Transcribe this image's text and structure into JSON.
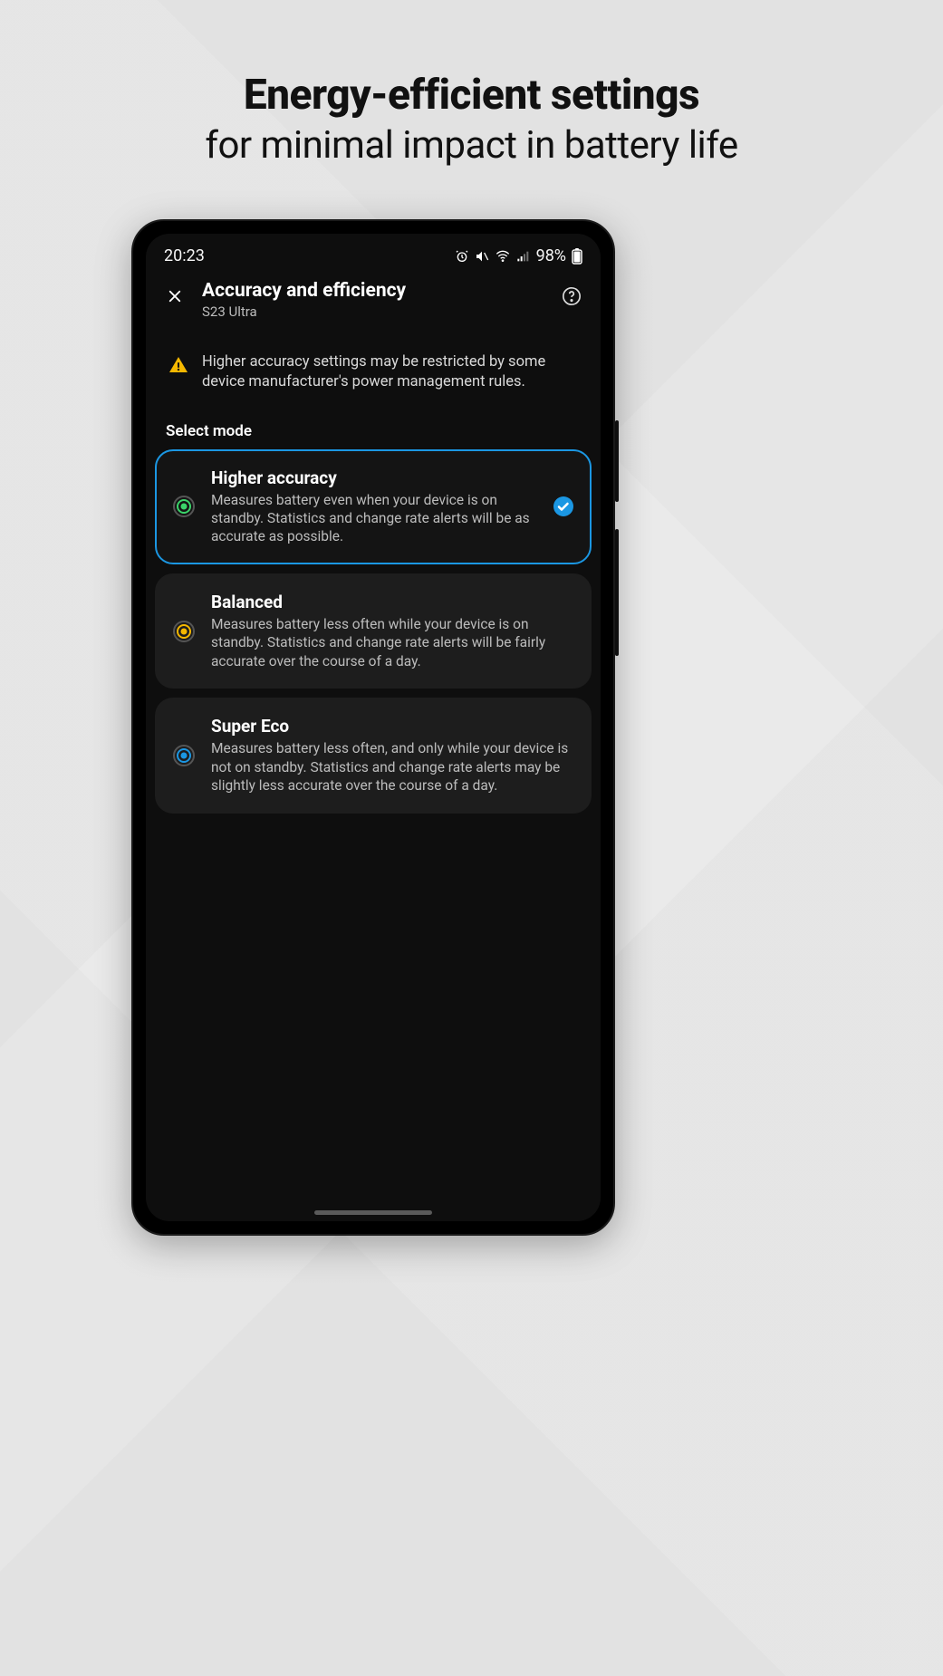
{
  "promo": {
    "title": "Energy-efficient settings",
    "subtitle": "for minimal impact in battery life"
  },
  "status": {
    "time": "20:23",
    "battery_pct": "98%"
  },
  "header": {
    "title": "Accuracy and efficiency",
    "subtitle": "S23 Ultra"
  },
  "warning": {
    "text": "Higher accuracy settings may be restricted by some device manufacturer's power management rules."
  },
  "section_label": "Select mode",
  "modes": [
    {
      "title": "Higher accuracy",
      "desc": "Measures battery even when your device is on standby. Statistics and change rate alerts will be as accurate as possible.",
      "selected": true,
      "radio_color": "#3bd46a"
    },
    {
      "title": "Balanced",
      "desc": "Measures battery less often while your device is on standby. Statistics and change rate alerts will be fairly accurate over the course of a day.",
      "selected": false,
      "radio_color": "#f5b800"
    },
    {
      "title": "Super Eco",
      "desc": "Measures battery less often, and only while your device is not on standby. Statistics and change rate alerts may be slightly less accurate over the course of a day.",
      "selected": false,
      "radio_color": "#1b97e3"
    }
  ],
  "colors": {
    "accent": "#1b97e3",
    "warn": "#f5b800"
  }
}
